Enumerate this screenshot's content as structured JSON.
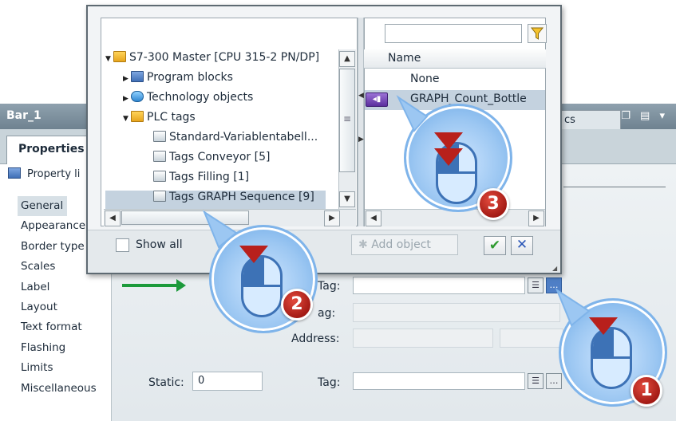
{
  "inspector": {
    "window_title": "Bar_1",
    "partial_tab": "cs",
    "properties_tab": "Properties",
    "property_list": "Property li",
    "nav_items": [
      "General",
      "Appearance",
      "Border type",
      "Scales",
      "Label",
      "Layout",
      "Text format",
      "Flashing",
      "Limits",
      "Miscellaneous"
    ],
    "selected_nav": "General",
    "tag_label_1": "Tag:",
    "tag_label_2": "ag:",
    "address_label": "Address:",
    "static_label": "Static:",
    "static_value": "0",
    "tag_label_3": "Tag:"
  },
  "dialog": {
    "tree": [
      {
        "label": "S7-300 Master [CPU 315-2 PN/DP]",
        "icon": "folder-icon",
        "expanded": true
      },
      {
        "label": "Program blocks",
        "icon": "blocks-icon",
        "expanded": false
      },
      {
        "label": "Technology objects",
        "icon": "technology-icon",
        "expanded": false
      },
      {
        "label": "PLC tags",
        "icon": "folder-icon",
        "expanded": true
      },
      {
        "label": "Standard-Variablentabell...",
        "icon": "tag-table-icon"
      },
      {
        "label": "Tags Conveyor [5]",
        "icon": "tag-table-icon"
      },
      {
        "label": "Tags Filling [1]",
        "icon": "tag-table-icon"
      },
      {
        "label": "Tags GRAPH Sequence [9]",
        "icon": "tag-table-icon",
        "selected": true
      }
    ],
    "list_header": "Name",
    "list_items": [
      {
        "label": "None"
      },
      {
        "label": "GRAPH_Count_Bottle",
        "selected": true
      }
    ],
    "show_all": "Show all",
    "add_object": "Add object"
  },
  "callouts": [
    "1",
    "2",
    "3"
  ],
  "colors": {
    "accent_blue": "#3d72b6",
    "badge_red": "#b8201c",
    "green_arrow": "#1c9a3b",
    "selection": "#c4d2df"
  }
}
